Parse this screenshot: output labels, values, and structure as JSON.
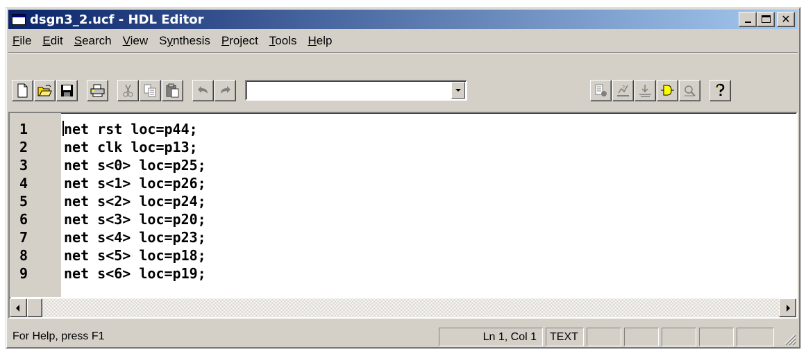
{
  "window": {
    "title": "dsgn3_2.ucf - HDL Editor",
    "caption_buttons": [
      "minimize-icon",
      "maximize-icon",
      "close-icon"
    ],
    "close_glyph": "✕"
  },
  "menu": [
    {
      "prefix": "",
      "key": "F",
      "rest": "ile"
    },
    {
      "prefix": "",
      "key": "E",
      "rest": "dit"
    },
    {
      "prefix": "",
      "key": "S",
      "rest": "earch"
    },
    {
      "prefix": "",
      "key": "V",
      "rest": "iew"
    },
    {
      "prefix": "S",
      "key": "y",
      "rest": "nthesis"
    },
    {
      "prefix": "",
      "key": "P",
      "rest": "roject"
    },
    {
      "prefix": "",
      "key": "T",
      "rest": "ools"
    },
    {
      "prefix": "",
      "key": "H",
      "rest": "elp"
    }
  ],
  "toolbar": {
    "icons": [
      "new-file-icon",
      "open-folder-icon",
      "save-disk-icon",
      "print-icon",
      "cut-icon",
      "copy-icon",
      "paste-icon",
      "undo-icon",
      "redo-icon",
      "synthesis-options-icon",
      "check-syntax-icon",
      "implement-icon",
      "gate-symbol-icon",
      "search-zoom-icon",
      "help-question-icon"
    ],
    "search_combo_value": ""
  },
  "editor": {
    "lines": [
      {
        "num": "1",
        "text": "net rst loc=p44;"
      },
      {
        "num": "2",
        "text": "net clk loc=p13;"
      },
      {
        "num": "3",
        "text": "net s<0> loc=p25;"
      },
      {
        "num": "4",
        "text": "net s<1> loc=p26;"
      },
      {
        "num": "5",
        "text": "net s<2> loc=p24;"
      },
      {
        "num": "6",
        "text": "net s<3> loc=p20;"
      },
      {
        "num": "7",
        "text": "net s<4> loc=p23;"
      },
      {
        "num": "8",
        "text": "net s<5> loc=p18;"
      },
      {
        "num": "9",
        "text": "net s<6> loc=p19;"
      }
    ]
  },
  "statusbar": {
    "help_text": "For Help, press F1",
    "position": "Ln 1, Col 1",
    "mode": "TEXT"
  },
  "colors": {
    "titlebar_start": "#0a246a",
    "titlebar_end": "#a6caf0",
    "face": "#d4d0c8",
    "editor_bg": "#ffffff"
  }
}
